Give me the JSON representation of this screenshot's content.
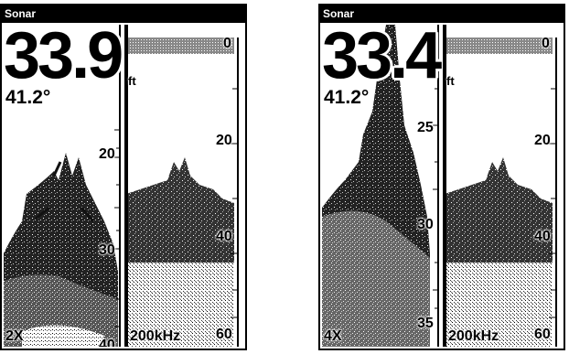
{
  "left": {
    "title": "Sonar",
    "depth": "33.9",
    "depth_unit": "ft",
    "temperature": "41.2°",
    "zoom": "2X",
    "frequency": "200kHz",
    "zoom_scale": [
      "20",
      "30",
      "40"
    ],
    "full_scale": [
      "0",
      "20",
      "40",
      "60"
    ]
  },
  "right": {
    "title": "Sonar",
    "depth": "33.4",
    "depth_unit": "ft",
    "temperature": "41.2°",
    "zoom": "4X",
    "frequency": "200kHz",
    "zoom_scale": [
      "25",
      "30",
      "35"
    ],
    "full_scale": [
      "0",
      "20",
      "40",
      "60"
    ]
  },
  "colors": {
    "sonar_return": "#000000",
    "background": "#ffffff"
  }
}
